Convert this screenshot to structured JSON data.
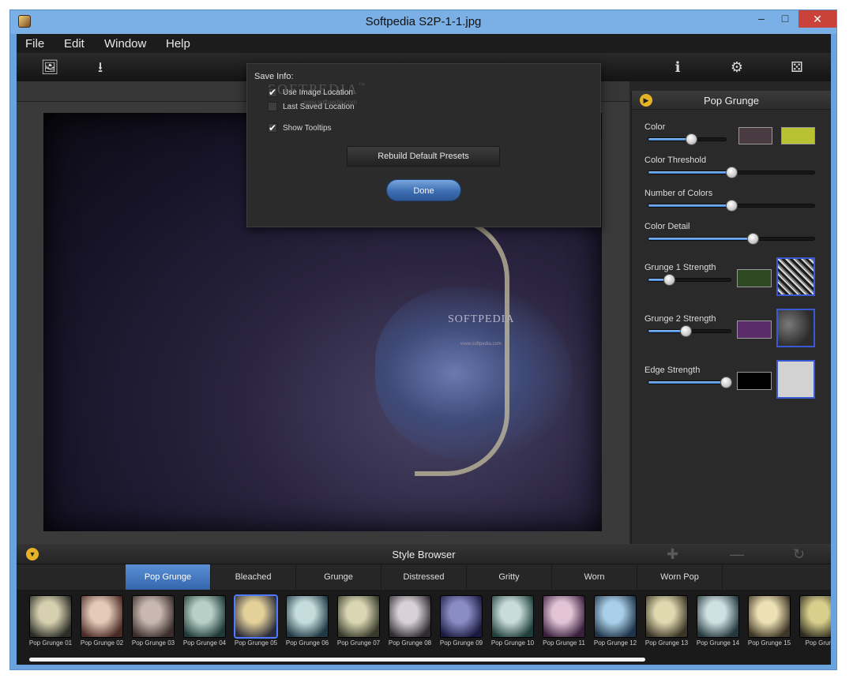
{
  "window": {
    "title": "Softpedia S2P-1-1.jpg",
    "min_glyph": "–",
    "max_glyph": "□",
    "close_glyph": "✕"
  },
  "menu": [
    "File",
    "Edit",
    "Window",
    "Help"
  ],
  "toolbar": {
    "left_icons": [
      "open-image-icon",
      "save-download-icon"
    ],
    "right_icons": [
      "info-icon",
      "settings-icon",
      "randomize-dice-icon"
    ],
    "glyphs": {
      "open": "🖼",
      "save": "⭳",
      "info": "ℹ",
      "settings": "⚙",
      "dice": "⚄"
    }
  },
  "photo": {
    "watermark": "SOFTPEDIA",
    "watermark_sub": "www.softpedia.com"
  },
  "save_dialog": {
    "title": "Save Info:",
    "options": [
      {
        "label": "Use Image Location",
        "checked": true
      },
      {
        "label": "Last Saved Location",
        "checked": false
      },
      {
        "label": "Show Tooltips",
        "checked": true
      }
    ],
    "watermark": "SOFTPEDIA",
    "watermark_tm": "™",
    "watermark_sub": "www.softpedia.com",
    "rebuild_label": "Rebuild Default Presets",
    "done_label": "Done",
    "check_glyph": "✔"
  },
  "right_panel": {
    "title": "Pop Grunge",
    "play_glyph": "▶",
    "params": [
      {
        "label": "Color",
        "value": 0.55,
        "swatches": [
          "#4a3a42",
          "#b9c232"
        ]
      },
      {
        "label": "Color Threshold",
        "value": 0.5
      },
      {
        "label": "Number of Colors",
        "value": 0.5
      },
      {
        "label": "Color Detail",
        "value": 0.63
      },
      {
        "label": "Grunge 1 Strength",
        "value": 0.25,
        "swatch": "#2f4a23",
        "texture": "grunge-texture-1"
      },
      {
        "label": "Grunge 2 Strength",
        "value": 0.45,
        "swatch": "#5a2d6a",
        "texture": "grunge-texture-2"
      },
      {
        "label": "Edge Strength",
        "value": 1.0,
        "swatch": "#000000",
        "texture": "edge-texture"
      }
    ]
  },
  "style_browser": {
    "title": "Style Browser",
    "toggle_glyph": "▼",
    "actions": {
      "add": "✚",
      "remove": "—",
      "reset": "↻"
    },
    "tabs": [
      "Pop Grunge",
      "Bleached",
      "Grunge",
      "Distressed",
      "Gritty",
      "Worn",
      "Worn Pop"
    ],
    "active_tab": 0,
    "presets": [
      {
        "label": "Pop Grunge 01",
        "colors": [
          "#d7d0b0",
          "#2a2d26"
        ]
      },
      {
        "label": "Pop Grunge 02",
        "colors": [
          "#e3c9b8",
          "#4a2a25"
        ]
      },
      {
        "label": "Pop Grunge 03",
        "colors": [
          "#c9b8b0",
          "#3a2d2c"
        ]
      },
      {
        "label": "Pop Grunge 04",
        "colors": [
          "#b7cfc6",
          "#1f3a38"
        ]
      },
      {
        "label": "Pop Grunge 05",
        "colors": [
          "#e4d19a",
          "#2a2a3a"
        ]
      },
      {
        "label": "Pop Grunge 06",
        "colors": [
          "#c4dcdc",
          "#203a45"
        ]
      },
      {
        "label": "Pop Grunge 07",
        "colors": [
          "#dad6b4",
          "#373a2a"
        ]
      },
      {
        "label": "Pop Grunge 08",
        "colors": [
          "#d8d2d6",
          "#2e2a30"
        ]
      },
      {
        "label": "Pop Grunge 09",
        "colors": [
          "#8a8cc4",
          "#1a1a40"
        ]
      },
      {
        "label": "Pop Grunge 10",
        "colors": [
          "#c8dcd8",
          "#1e3e3c"
        ]
      },
      {
        "label": "Pop Grunge 11",
        "colors": [
          "#e2c4d6",
          "#3a1f3c"
        ]
      },
      {
        "label": "Pop Grunge 12",
        "colors": [
          "#a9cfe8",
          "#1f3448"
        ]
      },
      {
        "label": "Pop Grunge 13",
        "colors": [
          "#e0d9b0",
          "#3a3426"
        ]
      },
      {
        "label": "Pop Grunge 14",
        "colors": [
          "#cfe0e2",
          "#24383d"
        ]
      },
      {
        "label": "Pop Grunge 15",
        "colors": [
          "#ece0b4",
          "#3c3424"
        ]
      },
      {
        "label": "Pop Grung",
        "colors": [
          "#d9cf8c",
          "#2b2a1c"
        ]
      }
    ],
    "selected_preset": 4
  }
}
